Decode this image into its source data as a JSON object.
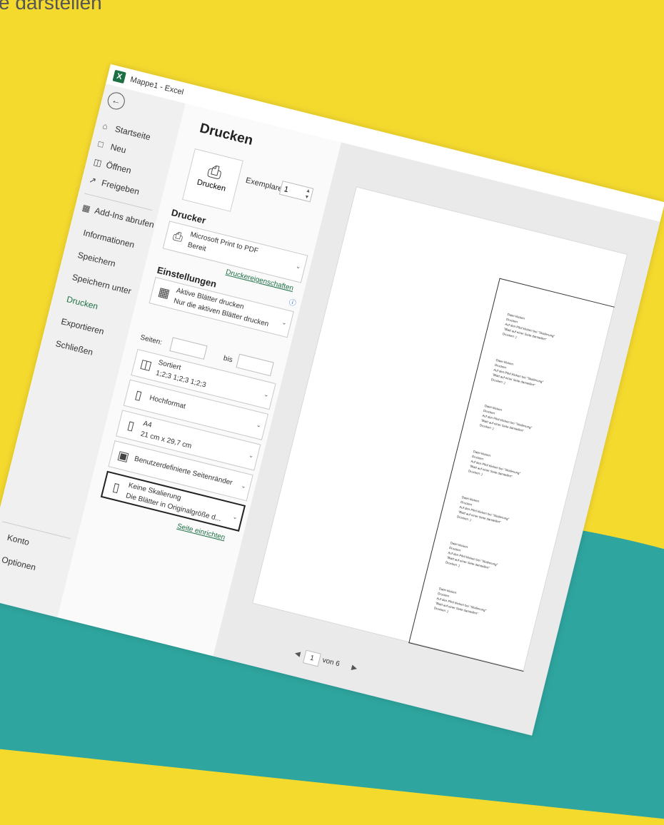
{
  "background": {
    "caption": "e darstellen"
  },
  "window": {
    "title": "Mappe1 - Excel"
  },
  "nav": {
    "top_items": [
      {
        "label": "Startseite",
        "icon": "home-icon"
      },
      {
        "label": "Neu",
        "icon": "new-file-icon"
      },
      {
        "label": "Öffnen",
        "icon": "folder-icon"
      },
      {
        "label": "Freigeben",
        "icon": "share-icon"
      }
    ],
    "addins": "Add-Ins abrufen",
    "mid_items": [
      "Informationen",
      "Speichern",
      "Speichern unter",
      "Drucken",
      "Exportieren",
      "Schließen"
    ],
    "active": "Drucken",
    "bottom_items": [
      "Konto",
      "Optionen"
    ]
  },
  "print": {
    "heading": "Drucken",
    "button_label": "Drucken",
    "copies_label": "Exemplare:",
    "copies_value": "1",
    "printer_heading": "Drucker",
    "printer_name": "Microsoft Print to PDF",
    "printer_status": "Bereit",
    "printer_properties": "Druckereigenschaften",
    "settings_heading": "Einstellungen",
    "what_line1": "Aktive Blätter drucken",
    "what_line2": "Nur die aktiven Blätter drucken",
    "pages_label": "Seiten:",
    "to_label": "bis",
    "collate_line1": "Sortiert",
    "collate_line2": "1;2;3   1;2;3   1;2;3",
    "orientation": "Hochformat",
    "paper_line1": "A4",
    "paper_line2": "21 cm x 29,7 cm",
    "margins": "Benutzerdefinierte Seitenränder",
    "scaling_line1": "Keine Skalierung",
    "scaling_line2": "Die Blätter in Originalgröße d...",
    "page_setup": "Seite einrichten"
  },
  "preview": {
    "block_lines": [
      "Datei klicken",
      "Drucken",
      "Auf den Pfeil klicken bei \"Skalierung\"",
      "\"Blatt auf einer Seite darstellen\"",
      "Drucken :)"
    ],
    "block_count": 7,
    "current_page": "1",
    "page_of": "von 6"
  }
}
